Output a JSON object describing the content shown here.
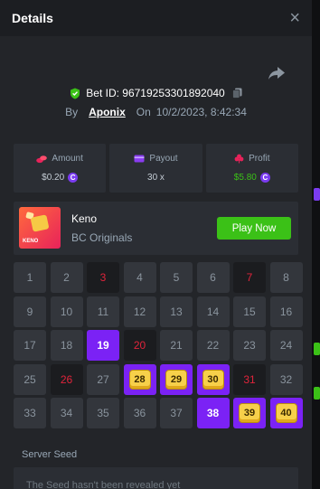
{
  "header": {
    "title": "Details",
    "close_glyph": "×"
  },
  "bet": {
    "id_label": "Bet ID: 96719253301892040",
    "by_label": "By",
    "username": "Aponix",
    "on_label": "On",
    "datetime": "10/2/2023, 8:42:34"
  },
  "stats": {
    "amount_label": "Amount",
    "amount_value": "$0.20",
    "payout_label": "Payout",
    "payout_value": "30 x",
    "profit_label": "Profit",
    "profit_value": "$5.80",
    "coin_glyph": "C"
  },
  "game": {
    "name": "Keno",
    "provider": "BC Originals",
    "play_label": "Play Now",
    "thumb_text": "KENO"
  },
  "board": {
    "numbers": [
      1,
      2,
      3,
      4,
      5,
      6,
      7,
      8,
      9,
      10,
      11,
      12,
      13,
      14,
      15,
      16,
      17,
      18,
      19,
      20,
      21,
      22,
      23,
      24,
      25,
      26,
      27,
      28,
      29,
      30,
      31,
      32,
      33,
      34,
      35,
      36,
      37,
      38,
      39,
      40
    ],
    "drawn_misses": [
      3,
      7,
      20,
      26,
      31
    ],
    "picked_misses": [
      19,
      38
    ],
    "hits": [
      28,
      29,
      30,
      39,
      40
    ]
  },
  "seed": {
    "label": "Server Seed",
    "text": "The Seed hasn't been revealed yet"
  },
  "colors": {
    "panel": "#232529",
    "header": "#1c1e22",
    "card": "#2b2e34",
    "accent_green": "#3bc117",
    "accent_purple": "#7b22f5",
    "drawn_red": "#e0243b",
    "gem_yellow": "#f7d04a"
  },
  "icons": {
    "close": "close-icon",
    "share": "share-icon",
    "shield": "shield-check-icon",
    "copy": "copy-icon",
    "amount": "coins-icon",
    "payout": "card-icon",
    "profit": "clover-icon"
  }
}
